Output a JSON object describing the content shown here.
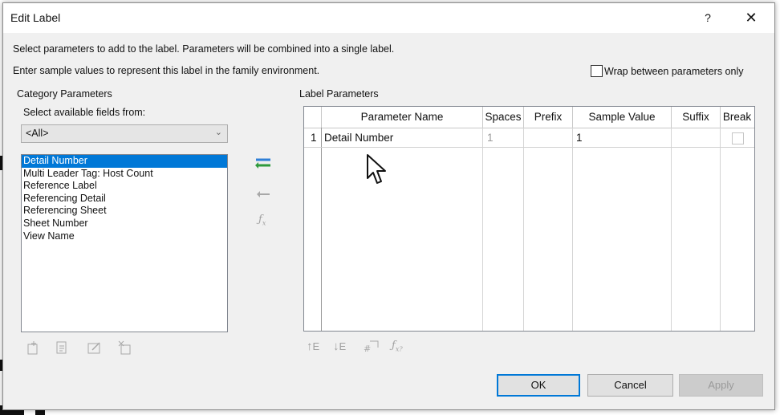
{
  "window": {
    "title": "Edit Label",
    "help_glyph": "?",
    "close_glyph": "✕"
  },
  "instructions": {
    "line1": "Select parameters to add to the label.  Parameters will be combined into a single label.",
    "line2": "Enter sample values to represent this label in the family environment."
  },
  "wrap_option": {
    "label": "Wrap between parameters only",
    "checked": false
  },
  "category": {
    "heading": "Category Parameters",
    "fields_label": "Select available fields from:",
    "selected_filter": "<All>",
    "items": [
      "Detail Number",
      "Multi Leader Tag: Host Count",
      "Reference Label",
      "Referencing Detail",
      "Referencing Sheet",
      "Sheet Number",
      "View Name"
    ],
    "selected_item": "Detail Number"
  },
  "label_params": {
    "heading": "Label Parameters",
    "columns": [
      "Parameter Name",
      "Spaces",
      "Prefix",
      "Sample Value",
      "Suffix",
      "Break"
    ],
    "rows": [
      {
        "index": "1",
        "name": "Detail Number",
        "spaces": "1",
        "prefix": "",
        "sample": "1",
        "suffix": "",
        "break": false
      }
    ]
  },
  "icons": {
    "add": "add-parameter-icon",
    "remove": "remove-parameter-icon",
    "fx": "fx-icon"
  },
  "buttons": {
    "ok": "OK",
    "cancel": "Cancel",
    "apply": "Apply"
  },
  "colors": {
    "selection": "#0078d7",
    "dialog_bg": "#f0f0f0",
    "add_arrow_blue": "#2f7fd6",
    "add_arrow_green": "#2e9a3c"
  }
}
